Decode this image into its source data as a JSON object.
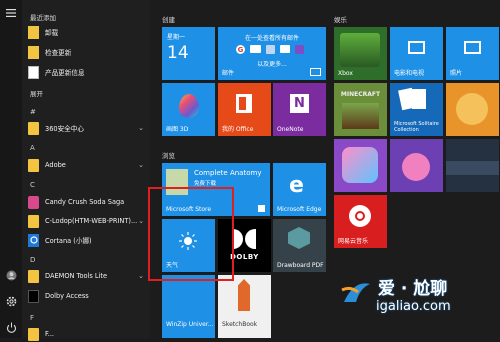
{
  "start_menu": {
    "recent_header": "最近添加",
    "recent": [
      {
        "label": "卸载",
        "icon": "doc-icon"
      },
      {
        "label": "检查更新",
        "icon": "doc-icon"
      },
      {
        "label": "产品更新信息",
        "icon": "doc-icon"
      }
    ],
    "expand": "展开",
    "sections": [
      {
        "letter": "#",
        "items": [
          {
            "label": "360安全中心",
            "icon": "folder-icon",
            "chevron": "⌄"
          }
        ]
      },
      {
        "letter": "A",
        "items": [
          {
            "label": "Adobe",
            "icon": "folder-icon",
            "chevron": "⌄"
          }
        ]
      },
      {
        "letter": "C",
        "items": [
          {
            "label": "Candy Crush Soda Saga",
            "icon": "candy-icon"
          },
          {
            "label": "C-Lodop(HTM-WEB-PRINT)...",
            "icon": "folder-icon",
            "chevron": "⌄"
          },
          {
            "label": "Cortana (小娜)",
            "icon": "cortana-icon"
          }
        ]
      },
      {
        "letter": "D",
        "items": [
          {
            "label": "DAEMON Tools Lite",
            "icon": "folder-icon",
            "chevron": "⌄"
          },
          {
            "label": "Dolby Access",
            "icon": "dolby-icon"
          }
        ]
      },
      {
        "letter": "F",
        "items": [
          {
            "label": "F...",
            "icon": "folder-icon"
          }
        ]
      }
    ]
  },
  "groups": {
    "create": "创建",
    "browse": "浏览",
    "entertain": "娱乐"
  },
  "tiles": {
    "calendar_day": "星期一",
    "calendar_date": "14",
    "mail_top": "在一处查看所有邮件",
    "mail_more": "以及更多...",
    "mail": "邮件",
    "paint3d": "画图 3D",
    "office": "我的 Office",
    "onenote": "OneNote",
    "xbox": "Xbox",
    "movies": "电影和电视",
    "photos": "照片",
    "minecraft": "MINECRAFT",
    "solitaire": "Microsoft Solitaire Collection",
    "anatomy_title": "Complete Anatomy",
    "anatomy_sub": "免费下载",
    "store": "Microsoft Store",
    "edge": "Microsoft Edge",
    "weather": "天气",
    "dolby": "DOLBY",
    "drawboard": "Drawboard PDF",
    "netease": "网易云音乐",
    "winzip": "WinZip Univer...",
    "sketchbook": "SketchBook"
  },
  "watermark": {
    "name": "爱 · 尬聊",
    "url": "igaliao.com"
  },
  "colors": {
    "tile_blue": "#1e90e6",
    "office_orange": "#e64a19",
    "onenote_purple": "#7b2c9f",
    "highlight_red": "#e02020"
  }
}
